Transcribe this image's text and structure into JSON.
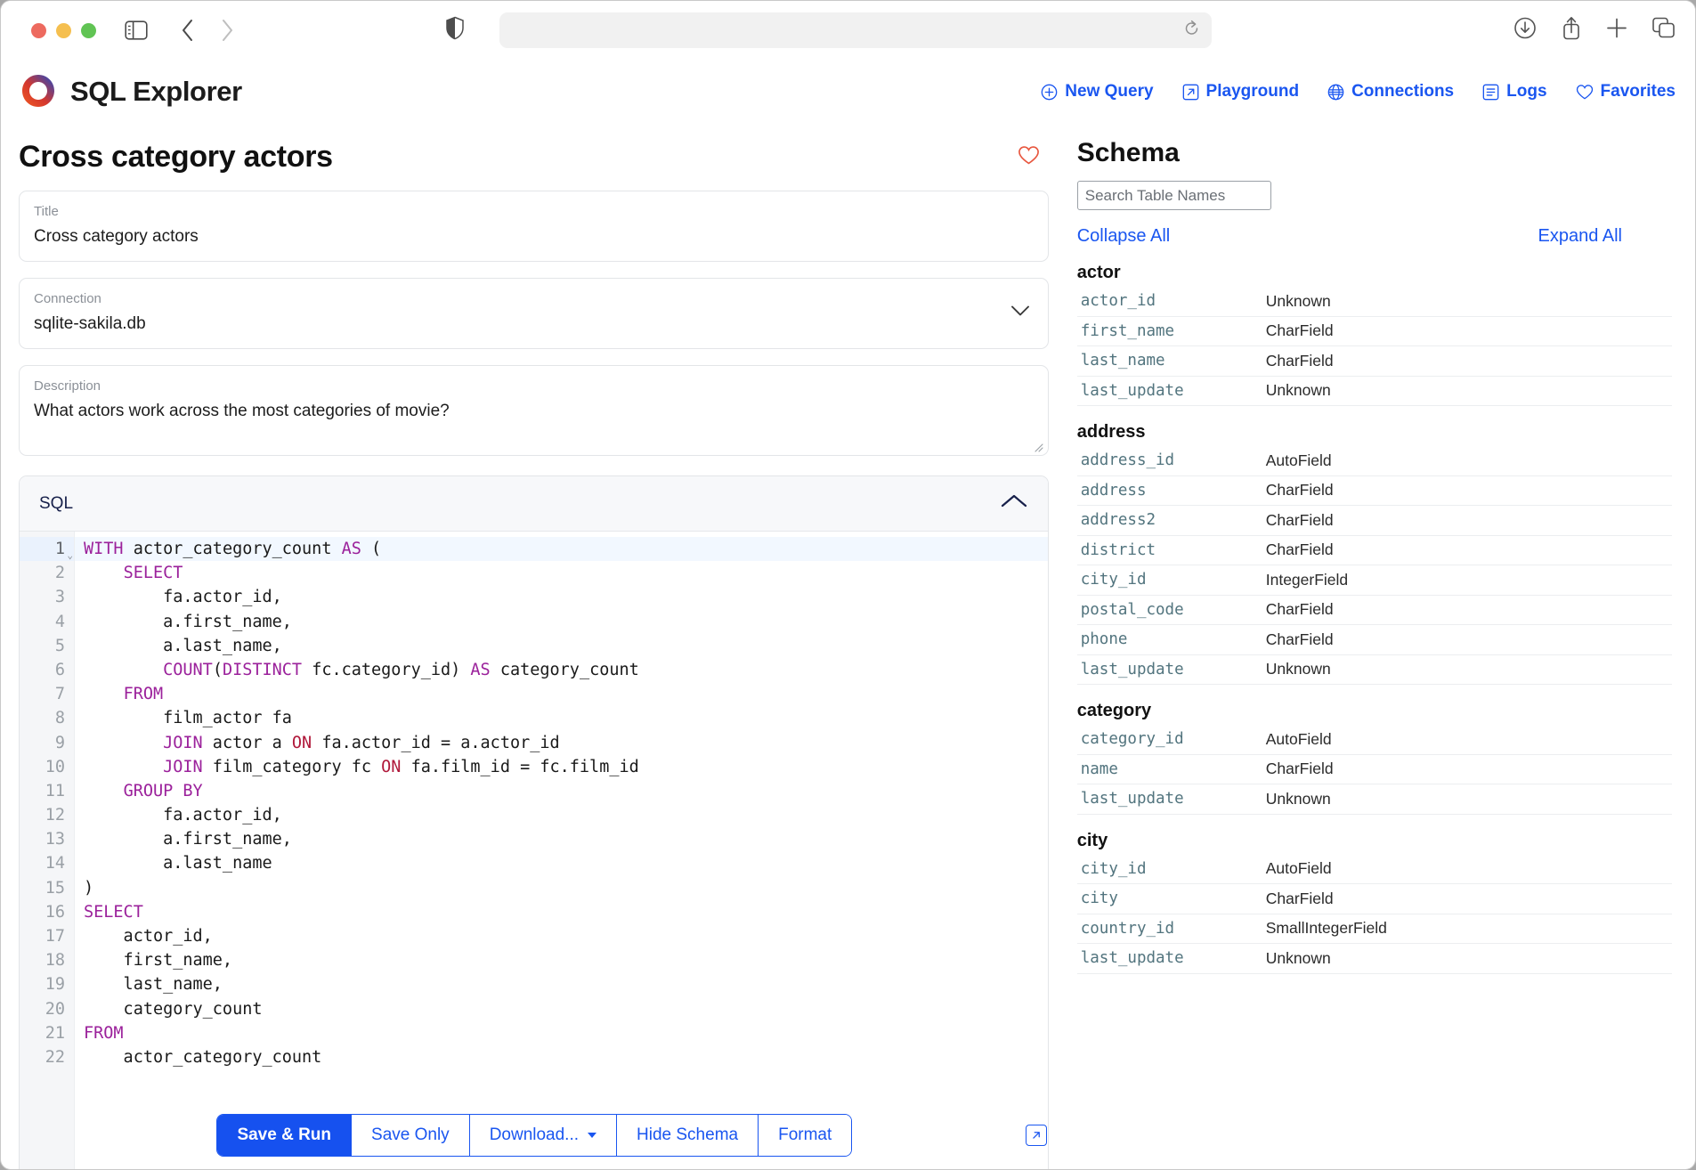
{
  "browser": {
    "url_value": "",
    "url_placeholder": "",
    "icons": {
      "sidebar": "sidebar-icon",
      "back": "back-chevron-icon",
      "forward": "forward-chevron-icon",
      "shield": "shield-icon",
      "reload": "reload-icon",
      "downloads": "download-icon",
      "share": "share-icon",
      "new_tab": "plus-icon",
      "tabs": "tab-overview-icon"
    }
  },
  "app": {
    "name": "SQL Explorer",
    "nav": [
      {
        "label": "New Query",
        "icon": "plus-circle-icon"
      },
      {
        "label": "Playground",
        "icon": "external-link-box-icon"
      },
      {
        "label": "Connections",
        "icon": "globe-icon"
      },
      {
        "label": "Logs",
        "icon": "list-box-icon"
      },
      {
        "label": "Favorites",
        "icon": "heart-outline-icon"
      }
    ],
    "accent": "#1a56f0"
  },
  "query": {
    "page_title": "Cross category actors",
    "favorite_icon": "heart-outline-icon",
    "favorite_color": "#e8573f",
    "fields": {
      "title": {
        "label": "Title",
        "value": "Cross category actors"
      },
      "connection": {
        "label": "Connection",
        "value": "sqlite-sakila.db"
      },
      "description": {
        "label": "Description",
        "value": "What actors work across the most categories of movie?"
      }
    },
    "sql_panel": {
      "label": "SQL",
      "collapse_icon": "chevron-up-icon",
      "active_line": 1,
      "lines": [
        {
          "n": "1",
          "tokens": [
            {
              "t": "WITH",
              "c": "kw"
            },
            {
              "t": " actor_category_count ",
              "c": ""
            },
            {
              "t": "AS",
              "c": "kw"
            },
            {
              "t": " (",
              "c": ""
            }
          ]
        },
        {
          "n": "2",
          "tokens": [
            {
              "t": "    ",
              "c": ""
            },
            {
              "t": "SELECT",
              "c": "kw"
            }
          ]
        },
        {
          "n": "3",
          "tokens": [
            {
              "t": "        fa.actor_id,",
              "c": ""
            }
          ]
        },
        {
          "n": "4",
          "tokens": [
            {
              "t": "        a.first_name,",
              "c": ""
            }
          ]
        },
        {
          "n": "5",
          "tokens": [
            {
              "t": "        a.last_name,",
              "c": ""
            }
          ]
        },
        {
          "n": "6",
          "tokens": [
            {
              "t": "        ",
              "c": ""
            },
            {
              "t": "COUNT",
              "c": "kw"
            },
            {
              "t": "(",
              "c": ""
            },
            {
              "t": "DISTINCT",
              "c": "kw"
            },
            {
              "t": " fc.category_id) ",
              "c": ""
            },
            {
              "t": "AS",
              "c": "kw"
            },
            {
              "t": " category_count",
              "c": ""
            }
          ]
        },
        {
          "n": "7",
          "tokens": [
            {
              "t": "    ",
              "c": ""
            },
            {
              "t": "FROM",
              "c": "kw"
            }
          ]
        },
        {
          "n": "8",
          "tokens": [
            {
              "t": "        film_actor fa",
              "c": ""
            }
          ]
        },
        {
          "n": "9",
          "tokens": [
            {
              "t": "        ",
              "c": ""
            },
            {
              "t": "JOIN",
              "c": "kw"
            },
            {
              "t": " actor a ",
              "c": ""
            },
            {
              "t": "ON",
              "c": "kw2"
            },
            {
              "t": " fa.actor_id = a.actor_id",
              "c": ""
            }
          ]
        },
        {
          "n": "10",
          "tokens": [
            {
              "t": "        ",
              "c": ""
            },
            {
              "t": "JOIN",
              "c": "kw"
            },
            {
              "t": " film_category fc ",
              "c": ""
            },
            {
              "t": "ON",
              "c": "kw2"
            },
            {
              "t": " fa.film_id = fc.film_id",
              "c": ""
            }
          ]
        },
        {
          "n": "11",
          "tokens": [
            {
              "t": "    ",
              "c": ""
            },
            {
              "t": "GROUP BY",
              "c": "kw"
            }
          ]
        },
        {
          "n": "12",
          "tokens": [
            {
              "t": "        fa.actor_id,",
              "c": ""
            }
          ]
        },
        {
          "n": "13",
          "tokens": [
            {
              "t": "        a.first_name,",
              "c": ""
            }
          ]
        },
        {
          "n": "14",
          "tokens": [
            {
              "t": "        a.last_name",
              "c": ""
            }
          ]
        },
        {
          "n": "15",
          "tokens": [
            {
              "t": ")",
              "c": ""
            }
          ]
        },
        {
          "n": "16",
          "tokens": [
            {
              "t": "SELECT",
              "c": "kw"
            }
          ]
        },
        {
          "n": "17",
          "tokens": [
            {
              "t": "    actor_id,",
              "c": ""
            }
          ]
        },
        {
          "n": "18",
          "tokens": [
            {
              "t": "    first_name,",
              "c": ""
            }
          ]
        },
        {
          "n": "19",
          "tokens": [
            {
              "t": "    last_name,",
              "c": ""
            }
          ]
        },
        {
          "n": "20",
          "tokens": [
            {
              "t": "    category_count",
              "c": ""
            }
          ]
        },
        {
          "n": "21",
          "tokens": [
            {
              "t": "FROM",
              "c": "kw"
            }
          ]
        },
        {
          "n": "22",
          "tokens": [
            {
              "t": "    actor_category_count",
              "c": ""
            }
          ]
        }
      ]
    },
    "buttons": [
      {
        "label": "Save & Run",
        "style": "primary"
      },
      {
        "label": "Save Only",
        "style": "default"
      },
      {
        "label": "Download...",
        "style": "default",
        "caret": true
      },
      {
        "label": "Hide Schema",
        "style": "default"
      },
      {
        "label": "Format",
        "style": "default"
      }
    ],
    "popout_icon": "external-link-icon"
  },
  "schema": {
    "title": "Schema",
    "search_placeholder": "Search Table Names",
    "search_value": "",
    "collapse_all": "Collapse All",
    "expand_all": "Expand All",
    "tables": [
      {
        "name": "actor",
        "columns": [
          {
            "name": "actor_id",
            "type": "Unknown"
          },
          {
            "name": "first_name",
            "type": "CharField"
          },
          {
            "name": "last_name",
            "type": "CharField"
          },
          {
            "name": "last_update",
            "type": "Unknown"
          }
        ]
      },
      {
        "name": "address",
        "columns": [
          {
            "name": "address_id",
            "type": "AutoField"
          },
          {
            "name": "address",
            "type": "CharField"
          },
          {
            "name": "address2",
            "type": "CharField"
          },
          {
            "name": "district",
            "type": "CharField"
          },
          {
            "name": "city_id",
            "type": "IntegerField"
          },
          {
            "name": "postal_code",
            "type": "CharField"
          },
          {
            "name": "phone",
            "type": "CharField"
          },
          {
            "name": "last_update",
            "type": "Unknown"
          }
        ]
      },
      {
        "name": "category",
        "columns": [
          {
            "name": "category_id",
            "type": "AutoField"
          },
          {
            "name": "name",
            "type": "CharField"
          },
          {
            "name": "last_update",
            "type": "Unknown"
          }
        ]
      },
      {
        "name": "city",
        "columns": [
          {
            "name": "city_id",
            "type": "AutoField"
          },
          {
            "name": "city",
            "type": "CharField"
          },
          {
            "name": "country_id",
            "type": "SmallIntegerField"
          },
          {
            "name": "last_update",
            "type": "Unknown"
          }
        ]
      }
    ]
  }
}
